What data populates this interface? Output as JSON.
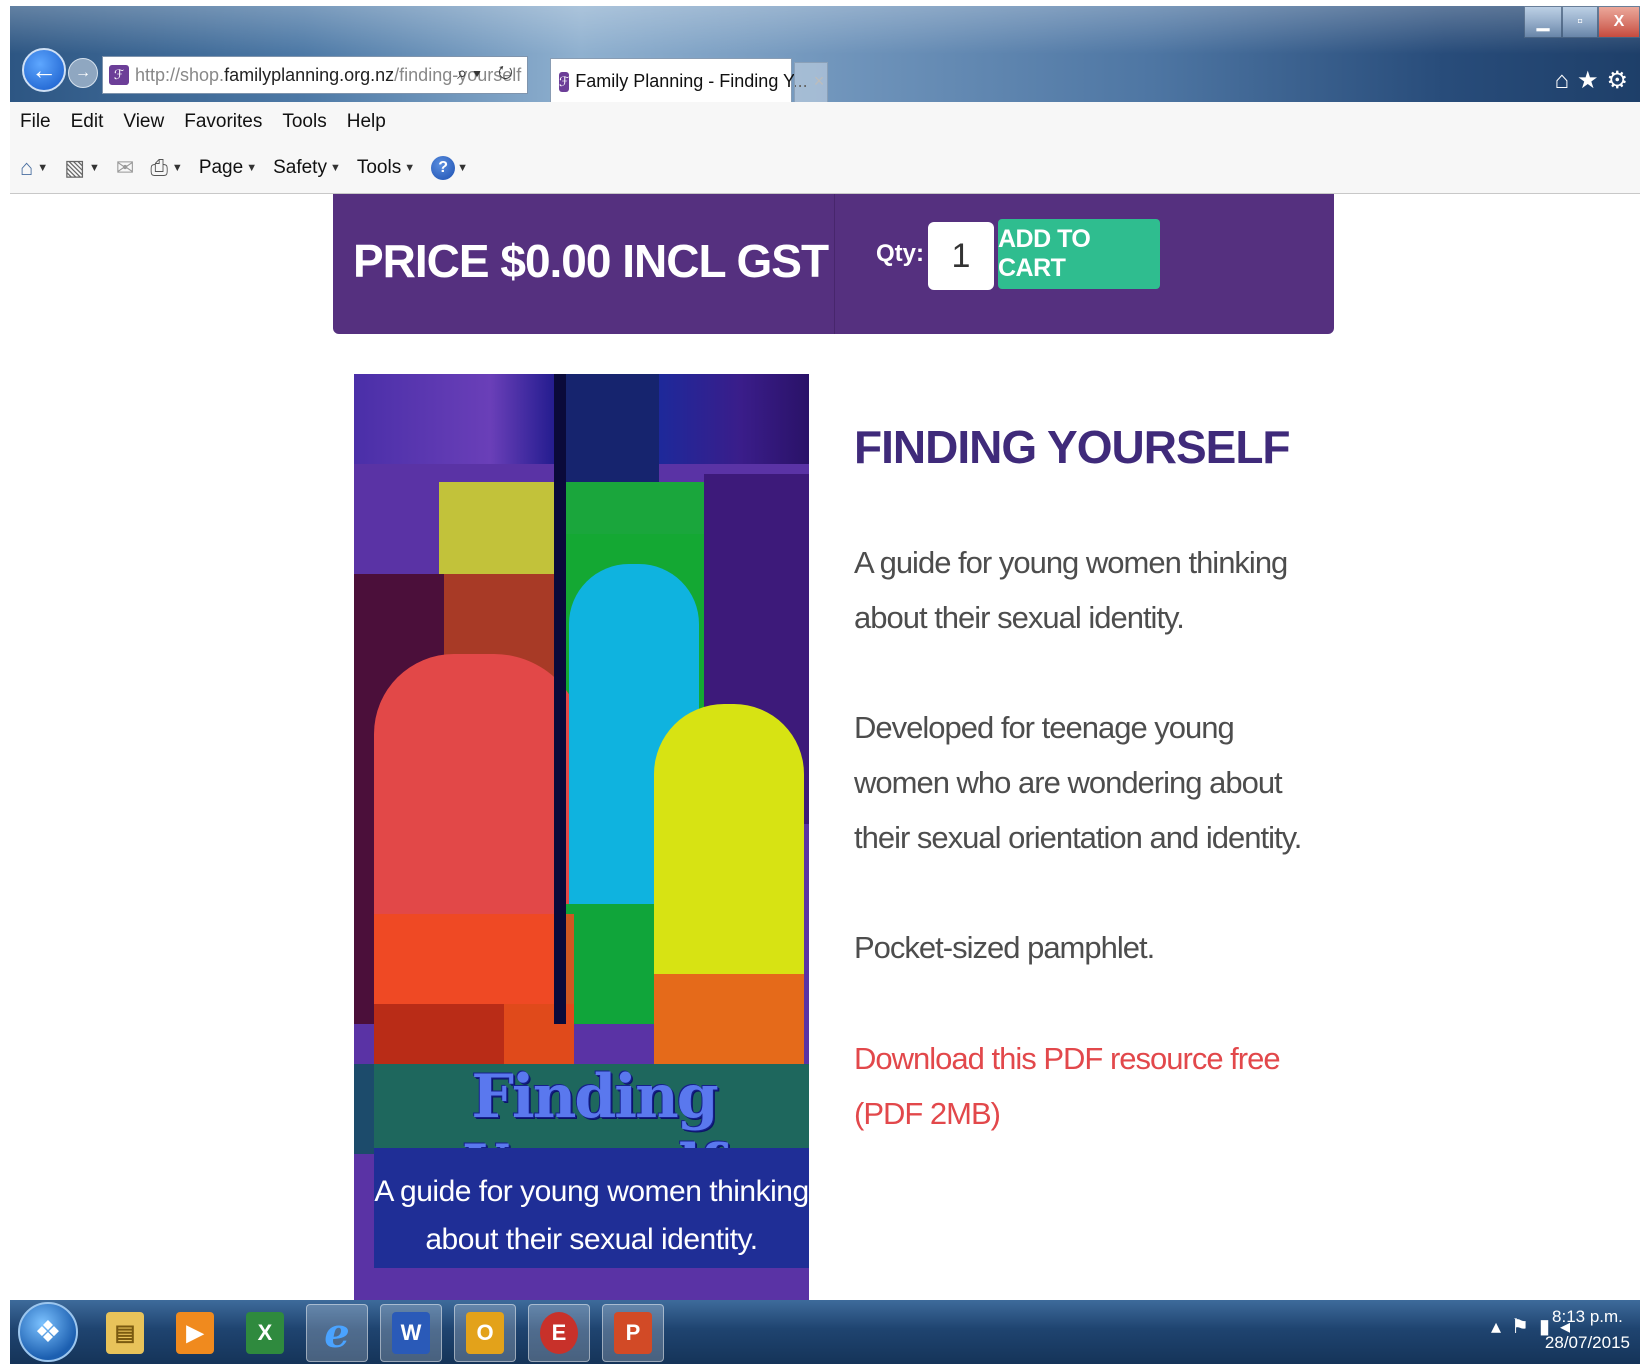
{
  "browser": {
    "url_prefix": "http://shop.",
    "url_host": "familyplanning.org.nz",
    "url_path": "/finding-yourself",
    "tab_title": "Family Planning - Finding Y...",
    "tab_close": "×",
    "addr_tools": "⌕▾ ↻",
    "right_icons": "⌂★⚙"
  },
  "window": {
    "minimize": "▁",
    "maximize": "▫",
    "close": "X"
  },
  "menu": [
    "File",
    "Edit",
    "View",
    "Favorites",
    "Tools",
    "Help"
  ],
  "command_bar": {
    "page": "Page",
    "safety": "Safety",
    "tools": "Tools"
  },
  "product": {
    "price_label": "PRICE $0.00 INCL GST",
    "qty_label": "Qty:",
    "qty_value": "1",
    "add_to_cart": "ADD TO CART",
    "title": "FINDING YOURSELF",
    "description": [
      "A guide for young women thinking about their sexual identity.",
      "Developed for teenage young women who are wondering about their sexual orientation and identity.",
      "Pocket-sized pamphlet."
    ],
    "download_link": "Download this PDF resource free (PDF 2MB)",
    "cover_title": "Finding Yourself",
    "cover_subtitle": "A guide for young women thinking about their sexual identity."
  },
  "taskbar": {
    "apps": [
      "explorer",
      "media-player",
      "excel",
      "internet-explorer",
      "word",
      "outlook",
      "tools",
      "powerpoint"
    ],
    "time": "8:13 p.m.",
    "date": "28/07/2015"
  },
  "colors": {
    "brand_purple": "#55307f",
    "cart_green": "#2fbd8f",
    "link_red": "#e2484b",
    "title_purple": "#3f2a7a"
  }
}
